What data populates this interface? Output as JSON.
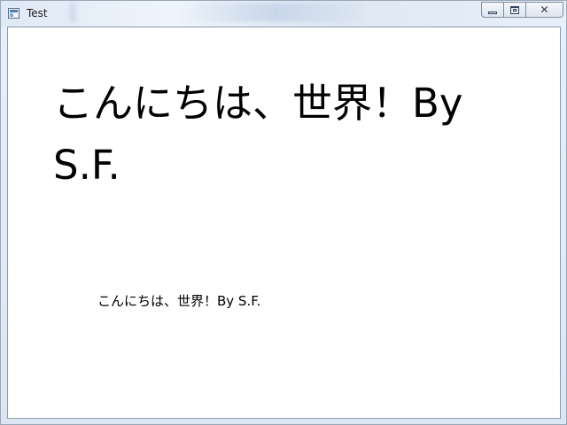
{
  "window": {
    "title": "Test",
    "controls": {
      "minimize_icon": "minimize-icon",
      "maximize_icon": "maximize-icon",
      "close_glyph": "☒"
    }
  },
  "content": {
    "large_text": "こんにちは、世界！By S.F.",
    "small_text": "こんにちは、世界！By S.F."
  },
  "colors": {
    "text": "#000000",
    "background": "#ffffff",
    "titlebar": "#dfe9f5"
  }
}
